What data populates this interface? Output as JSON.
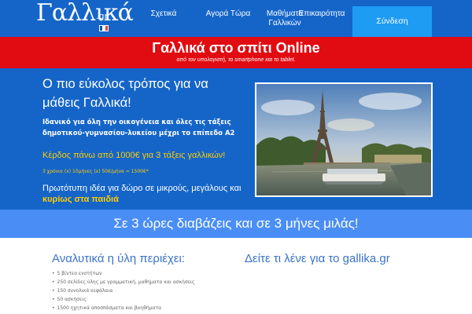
{
  "header": {
    "logo_text": "Γαλλικά",
    "logo_suffix": ".gr",
    "flag_colors": [
      "#0055a4",
      "#ffffff",
      "#ef4135"
    ],
    "nav": [
      {
        "label": "Σχετικά"
      },
      {
        "label": "Αγορά Τώρα"
      },
      {
        "label": "Μαθήματα Γαλλικών"
      },
      {
        "label": "Επικαιρότητα"
      }
    ],
    "login_label": "Σύνδεση"
  },
  "banner": {
    "title": "Γαλλικά στο σπίτι Online",
    "subtitle": "από τον υπολογιστή, το smartphone και το tablet."
  },
  "hero": {
    "headline": "Ο πιο εύκολος τρόπος για να μάθεις Γαλλικά!",
    "description": "Ιδανικό για όλη την οικογένεια και όλες τις τάξεις δημοτικού-γυμνασίου-λυκείου μέχρι το επίπεδο Α2",
    "promo": "Κέρδος πάνω από 1000€ για 3 τάξεις γαλλικών!",
    "promo_calc": "3 χρόνια (x) 10μήνες (x) 50€/μήνα = 1500€*",
    "gift_text": "Πρωτότυπη ιδέα για δώρο σε μικρούς, μεγάλους και",
    "gift_highlight": "κυρίως στα παιδιά"
  },
  "slogan": "Σε 3 ώρες διαβάζεις και σε 3 μήνες μιλάς!",
  "content": {
    "left_title": "Αναλυτικά η ύλη περιέχει:",
    "items": [
      "5 βίντεο ενοτήτων",
      "250 σελίδες ύλης με γραμματική, μαθήματα και ασκήσεις",
      "150 συνολικά κεφάλαια",
      "50 ασκήσεις",
      "1500 ηχητικά αποσπάσματα και βοηθήματα"
    ],
    "right_title": "Δείτε τι λένε για το gallika.gr"
  },
  "colors": {
    "primary_blue": "#1565c9",
    "banner_red": "#e10b12",
    "login_blue": "#1e9cf4",
    "slogan_blue": "#4a8ef5",
    "highlight_yellow": "#ffcc00",
    "title_blue": "#3b73c8"
  }
}
